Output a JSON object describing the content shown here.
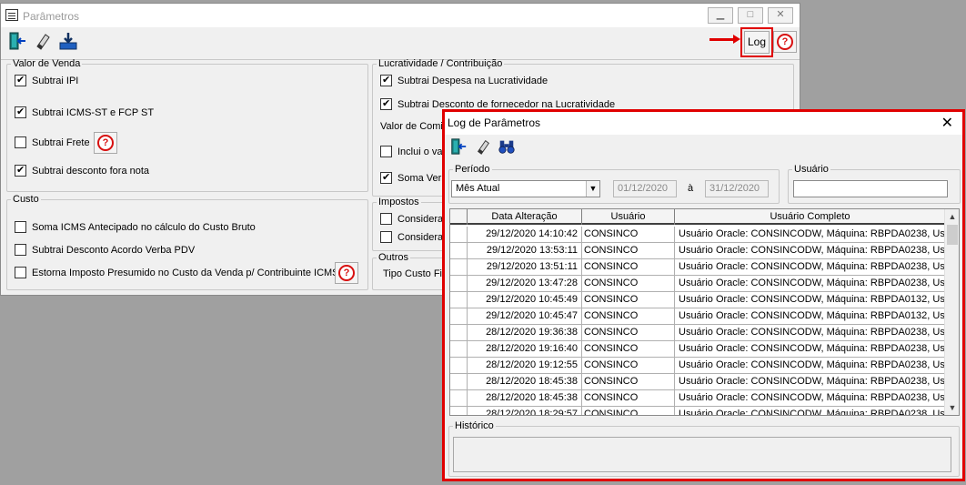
{
  "main": {
    "title": "Parâmetros",
    "log_label": "Log",
    "help_symbol": "?",
    "window_buttons": {
      "minimize": "▁",
      "maximize": "□",
      "close": "✕"
    },
    "valor_venda": {
      "legend": "Valor de Venda",
      "items": [
        {
          "label": "Subtrai IPI",
          "checked": true
        },
        {
          "label": "Subtrai ICMS-ST e FCP ST",
          "checked": true
        },
        {
          "label": "Subtrai Frete",
          "checked": false
        },
        {
          "label": "Subtrai desconto fora nota",
          "checked": true
        }
      ]
    },
    "custo": {
      "legend": "Custo",
      "items": [
        {
          "label": "Soma ICMS Antecipado no cálculo do Custo Bruto",
          "checked": false
        },
        {
          "label": "Subtrai Desconto Acordo Verba PDV",
          "checked": false
        },
        {
          "label": "Estorna Imposto Presumido no Custo da Venda p/ Contribuinte ICMS",
          "checked": false
        }
      ]
    },
    "lucratividade": {
      "legend": "Lucratividade / Contribuição",
      "items": [
        {
          "label": "Subtrai Despesa na Lucratividade",
          "checked": true
        },
        {
          "label": "Subtrai Desconto de fornecedor na Lucratividade",
          "checked": true
        }
      ],
      "valor_comis": "Valor de Comis",
      "inclui": {
        "label": "Inclui o val",
        "checked": false
      },
      "soma": {
        "label": "Soma Verb",
        "checked": true
      }
    },
    "impostos": {
      "legend": "Impostos",
      "items": [
        {
          "label": "Considera",
          "checked": false
        },
        {
          "label": "Considera",
          "checked": false
        }
      ]
    },
    "outros": {
      "legend": "Outros",
      "tipo": "Tipo Custo Fis"
    }
  },
  "dialog": {
    "title": "Log de Parâmetros",
    "close": "✕",
    "periodo": {
      "legend": "Período",
      "selected": "Mês Atual",
      "from": "01/12/2020",
      "sep": "à",
      "to": "31/12/2020"
    },
    "usuario": {
      "legend": "Usuário",
      "value": ""
    },
    "grid": {
      "columns": [
        "",
        "Data Alteração",
        "Usuário",
        "Usuário Completo"
      ],
      "rows": [
        {
          "date": "29/12/2020 14:10:42",
          "user": "CONSINCO",
          "full": "Usuário Oracle: CONSINCODW, Máquina: RBPDA0238, Us"
        },
        {
          "date": "29/12/2020 13:53:11",
          "user": "CONSINCO",
          "full": "Usuário Oracle: CONSINCODW, Máquina: RBPDA0238, Us"
        },
        {
          "date": "29/12/2020 13:51:11",
          "user": "CONSINCO",
          "full": "Usuário Oracle: CONSINCODW, Máquina: RBPDA0238, Us"
        },
        {
          "date": "29/12/2020 13:47:28",
          "user": "CONSINCO",
          "full": "Usuário Oracle: CONSINCODW, Máquina: RBPDA0238, Us"
        },
        {
          "date": "29/12/2020 10:45:49",
          "user": "CONSINCO",
          "full": "Usuário Oracle: CONSINCODW, Máquina: RBPDA0132, Us"
        },
        {
          "date": "29/12/2020 10:45:47",
          "user": "CONSINCO",
          "full": "Usuário Oracle: CONSINCODW, Máquina: RBPDA0132, Us"
        },
        {
          "date": "28/12/2020 19:36:38",
          "user": "CONSINCO",
          "full": "Usuário Oracle: CONSINCODW, Máquina: RBPDA0238, Us"
        },
        {
          "date": "28/12/2020 19:16:40",
          "user": "CONSINCO",
          "full": "Usuário Oracle: CONSINCODW, Máquina: RBPDA0238, Us"
        },
        {
          "date": "28/12/2020 19:12:55",
          "user": "CONSINCO",
          "full": "Usuário Oracle: CONSINCODW, Máquina: RBPDA0238, Us"
        },
        {
          "date": "28/12/2020 18:45:38",
          "user": "CONSINCO",
          "full": "Usuário Oracle: CONSINCODW, Máquina: RBPDA0238, Us"
        },
        {
          "date": "28/12/2020 18:45:38",
          "user": "CONSINCO",
          "full": "Usuário Oracle: CONSINCODW, Máquina: RBPDA0238, Us"
        },
        {
          "date": "28/12/2020 18:29:57",
          "user": "CONSINCO",
          "full": "Usuário Oracle: CONSINCODW, Máquina: RBPDA0238, Us"
        }
      ]
    },
    "historico": {
      "legend": "Histórico",
      "value": ""
    }
  },
  "icons": {
    "exit": "exit-door-icon",
    "eraser": "eraser-icon",
    "export": "export-download-icon",
    "binoculars": "binoculars-icon",
    "help": "help-icon"
  },
  "colors": {
    "highlight": "#e00000",
    "help": "#d81010"
  }
}
